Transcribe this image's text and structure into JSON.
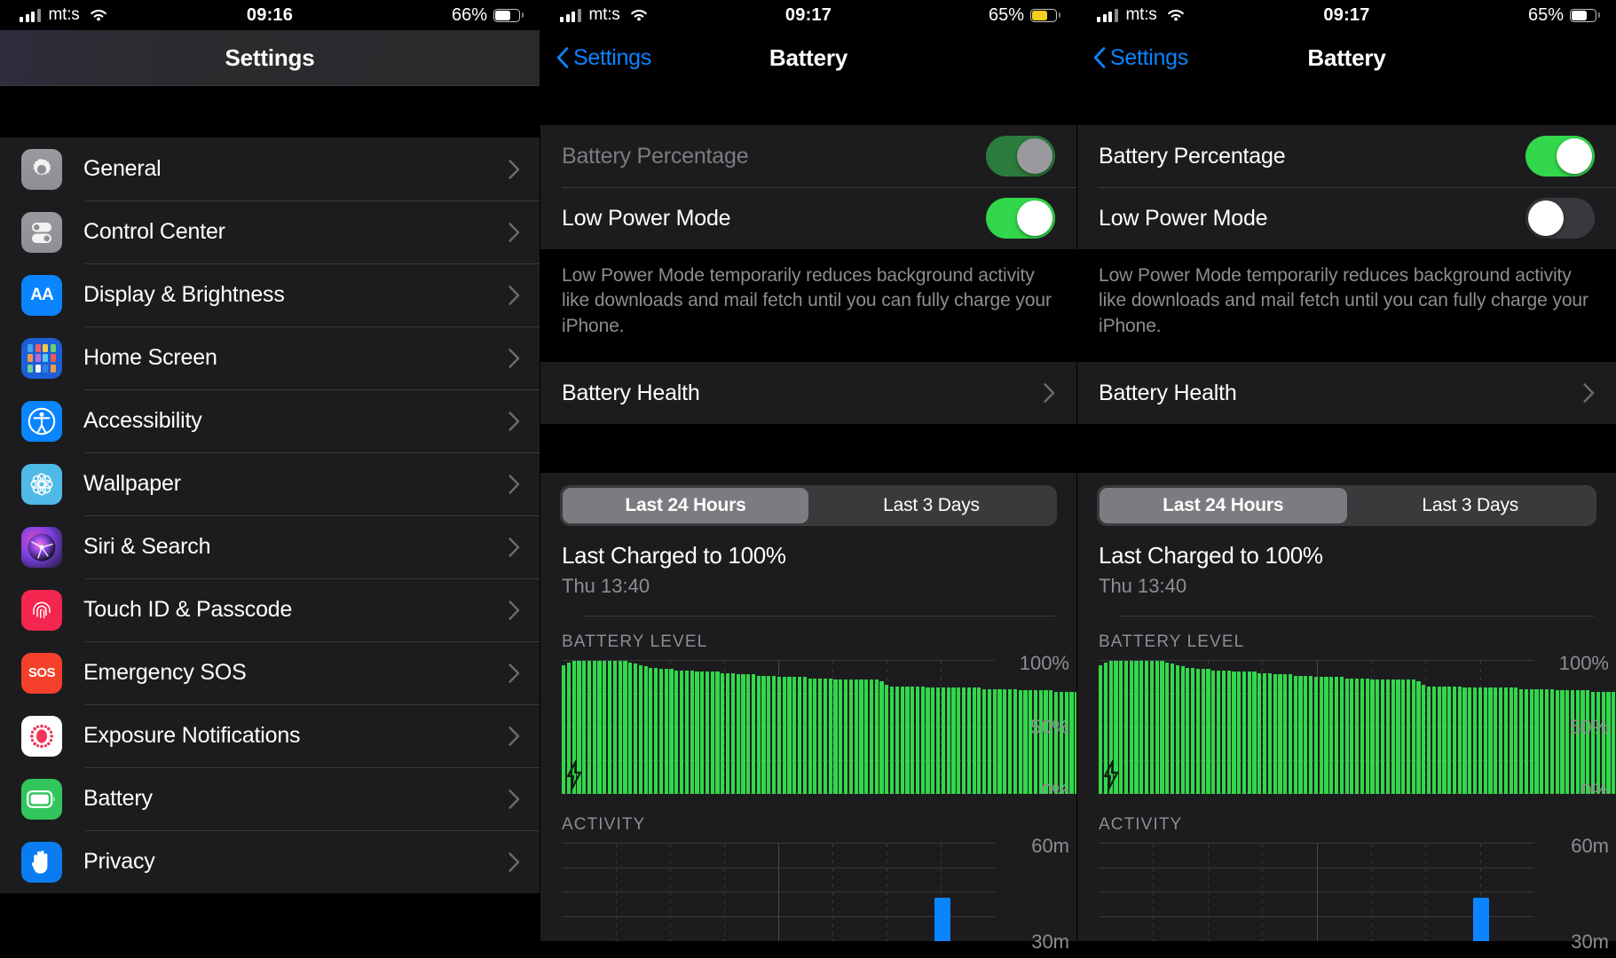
{
  "panels": [
    {
      "id": "settings-list",
      "status": {
        "carrier": "mt:s",
        "time": "09:16",
        "battery_pct": "66%",
        "battery_level": 66,
        "battery_color": "#ffffff"
      },
      "nav": {
        "title": "Settings",
        "back_label": null
      },
      "items": [
        {
          "label": "General",
          "icon": "gear-icon"
        },
        {
          "label": "Control Center",
          "icon": "control-center-icon"
        },
        {
          "label": "Display & Brightness",
          "icon": "display-brightness-icon",
          "glyph": "AA"
        },
        {
          "label": "Home Screen",
          "icon": "home-screen-icon"
        },
        {
          "label": "Accessibility",
          "icon": "accessibility-icon"
        },
        {
          "label": "Wallpaper",
          "icon": "wallpaper-icon"
        },
        {
          "label": "Siri & Search",
          "icon": "siri-icon"
        },
        {
          "label": "Touch ID & Passcode",
          "icon": "touch-id-icon"
        },
        {
          "label": "Emergency SOS",
          "icon": "sos-icon",
          "glyph": "SOS"
        },
        {
          "label": "Exposure Notifications",
          "icon": "exposure-notifications-icon"
        },
        {
          "label": "Battery",
          "icon": "battery-icon"
        },
        {
          "label": "Privacy",
          "icon": "privacy-hand-icon"
        }
      ]
    },
    {
      "id": "battery-low-power-on",
      "status": {
        "carrier": "mt:s",
        "time": "09:17",
        "battery_pct": "65%",
        "battery_level": 65,
        "battery_color": "#f5cf1f"
      },
      "nav": {
        "title": "Battery",
        "back_label": "Settings"
      },
      "toggles": [
        {
          "label": "Battery Percentage",
          "state": "on",
          "enabled": false
        },
        {
          "label": "Low Power Mode",
          "state": "on",
          "enabled": true
        }
      ],
      "footnote": "Low Power Mode temporarily reduces background activity like downloads and mail fetch until you can fully charge your iPhone.",
      "health_row": "Battery Health",
      "segments": [
        "Last 24 Hours",
        "Last 3 Days"
      ],
      "selected_segment": "Last 24 Hours",
      "charged_title": "Last Charged to 100%",
      "charged_sub": "Thu 13:40",
      "battery_level_head": "BATTERY LEVEL",
      "activity_head": "ACTIVITY",
      "level_ylabels": [
        "100%",
        "50%",
        "0%"
      ],
      "activity_ylabels": [
        "60m",
        "30m"
      ]
    },
    {
      "id": "battery-low-power-off",
      "status": {
        "carrier": "mt:s",
        "time": "09:17",
        "battery_pct": "65%",
        "battery_level": 65,
        "battery_color": "#ffffff"
      },
      "nav": {
        "title": "Battery",
        "back_label": "Settings"
      },
      "toggles": [
        {
          "label": "Battery Percentage",
          "state": "on",
          "enabled": true
        },
        {
          "label": "Low Power Mode",
          "state": "off",
          "enabled": true
        }
      ],
      "footnote": "Low Power Mode temporarily reduces background activity like downloads and mail fetch until you can fully charge your iPhone.",
      "health_row": "Battery Health",
      "segments": [
        "Last 24 Hours",
        "Last 3 Days"
      ],
      "selected_segment": "Last 24 Hours",
      "charged_title": "Last Charged to 100%",
      "charged_sub": "Thu 13:40",
      "battery_level_head": "BATTERY LEVEL",
      "activity_head": "ACTIVITY",
      "level_ylabels": [
        "100%",
        "50%",
        "0%"
      ],
      "activity_ylabels": [
        "60m",
        "30m"
      ]
    }
  ],
  "chart_data": [
    {
      "type": "bar",
      "title": "BATTERY LEVEL",
      "ylabel": "Battery level",
      "ylim": [
        0,
        100
      ],
      "yticks": [
        0,
        50,
        100
      ],
      "ytick_labels": [
        "0%",
        "50%",
        "100%"
      ],
      "grid": true,
      "bar_color": "#32d74b",
      "annotation": "charging-bolt at start of window",
      "values": [
        97,
        99,
        100,
        100,
        100,
        100,
        100,
        100,
        100,
        100,
        100,
        100,
        100,
        99,
        98,
        97,
        96,
        95,
        95,
        94,
        94,
        94,
        93,
        93,
        93,
        93,
        92,
        92,
        92,
        92,
        92,
        91,
        91,
        91,
        90,
        90,
        90,
        90,
        89,
        89,
        89,
        89,
        88,
        88,
        88,
        88,
        88,
        88,
        87,
        87,
        87,
        87,
        87,
        86,
        86,
        86,
        86,
        86,
        86,
        86,
        86,
        86,
        85,
        82,
        81,
        81,
        81,
        81,
        81,
        81,
        81,
        80,
        80,
        80,
        80,
        80,
        80,
        80,
        80,
        80,
        80,
        80,
        79,
        79,
        79,
        79,
        79,
        79,
        79,
        78,
        78,
        78,
        78,
        78,
        78,
        78,
        77,
        77,
        77,
        77,
        77,
        77,
        76,
        76,
        76,
        76,
        75,
        75,
        74,
        72,
        69,
        68,
        68
      ]
    },
    {
      "type": "bar",
      "title": "ACTIVITY",
      "ylabel": "Screen time",
      "ylim": [
        0,
        60
      ],
      "yticks": [
        30,
        60
      ],
      "ytick_labels": [
        "30m",
        "60m"
      ],
      "grid": true,
      "bar_color": "#0a84ff",
      "values_visible": [
        {
          "x_frac": 0.86,
          "minutes": 27
        }
      ]
    }
  ]
}
